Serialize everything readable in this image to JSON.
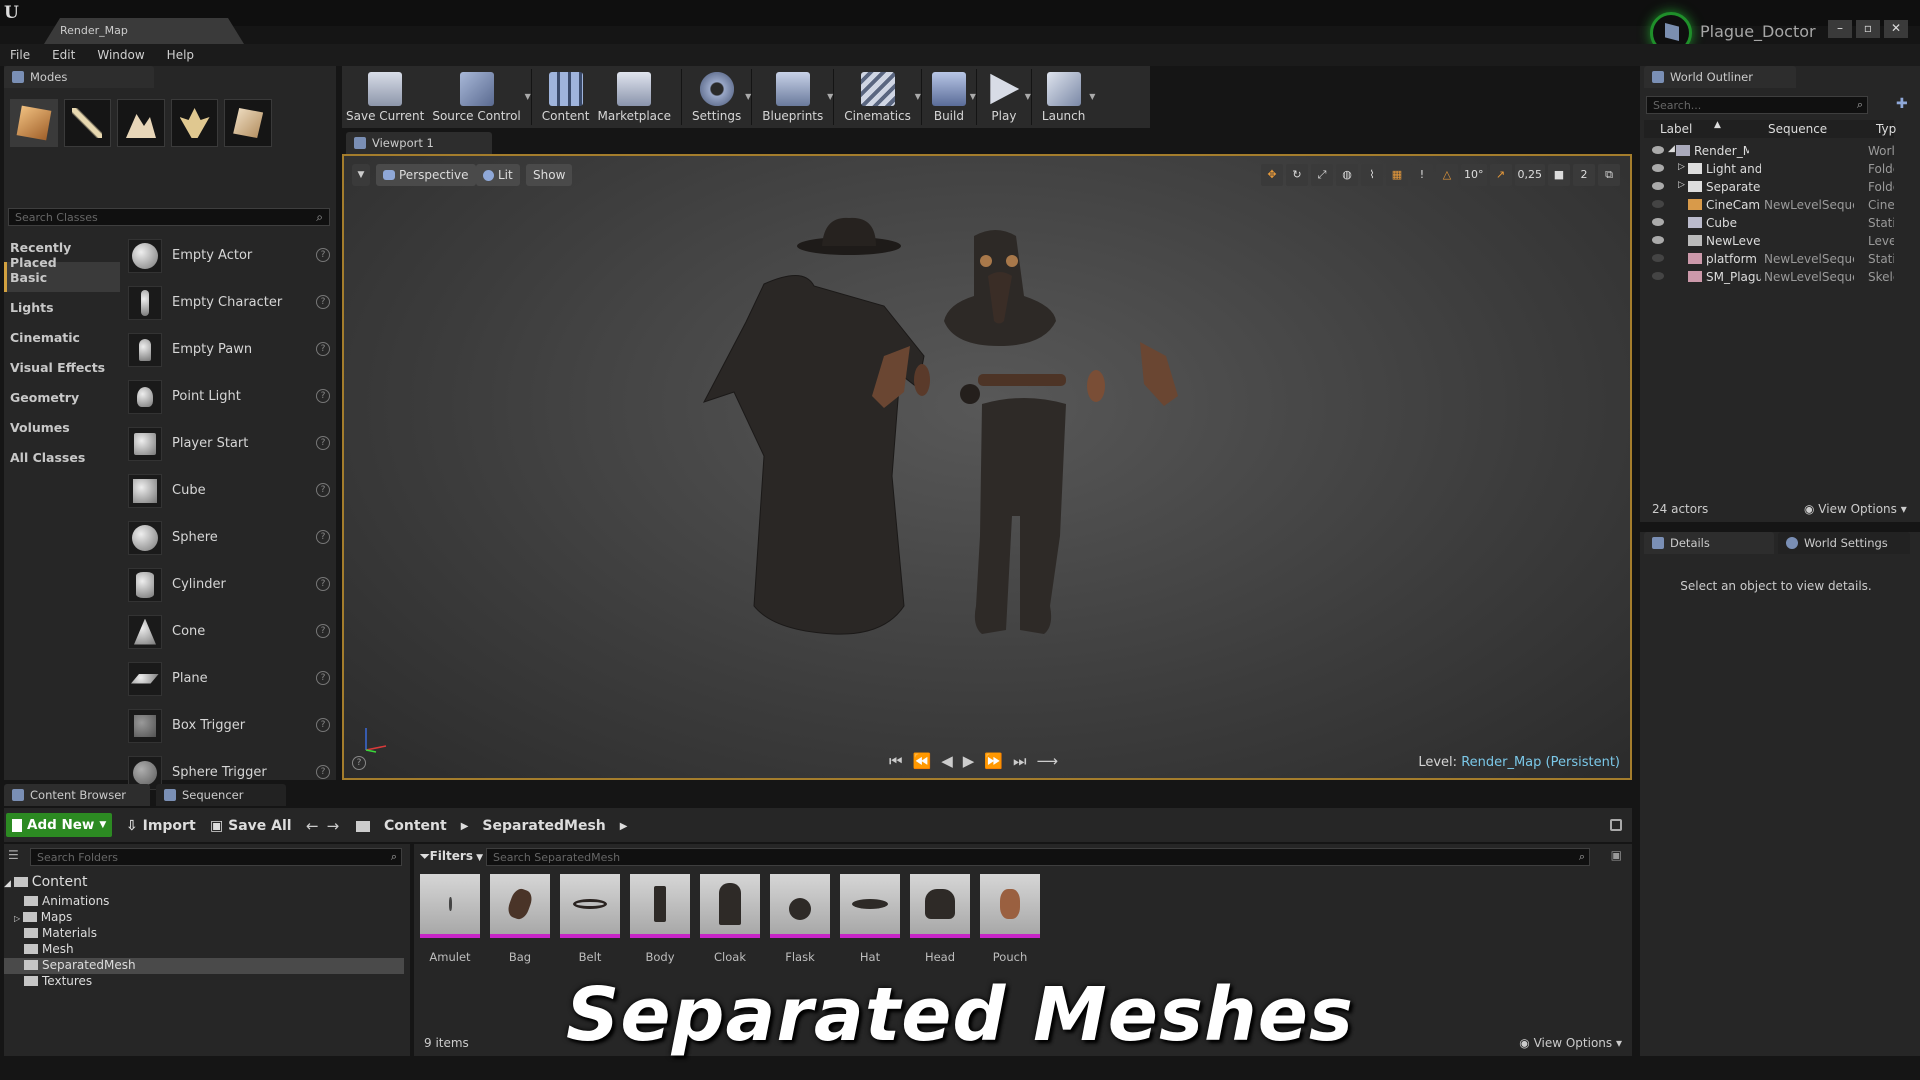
{
  "window": {
    "doc_tab": "Render_Map",
    "project": "Plague_Doctor"
  },
  "menu": [
    "File",
    "Edit",
    "Window",
    "Help"
  ],
  "modes": {
    "tab": "Modes",
    "search_placeholder": "Search Classes",
    "categories": [
      "Recently Placed",
      "Basic",
      "Lights",
      "Cinematic",
      "Visual Effects",
      "Geometry",
      "Volumes",
      "All Classes"
    ],
    "items": [
      "Empty Actor",
      "Empty Character",
      "Empty Pawn",
      "Point Light",
      "Player Start",
      "Cube",
      "Sphere",
      "Cylinder",
      "Cone",
      "Plane",
      "Box Trigger",
      "Sphere Trigger"
    ]
  },
  "toolbar": {
    "save": "Save Current",
    "source": "Source Control",
    "content": "Content",
    "marketplace": "Marketplace",
    "settings": "Settings",
    "blueprints": "Blueprints",
    "cinematics": "Cinematics",
    "build": "Build",
    "play": "Play",
    "launch": "Launch"
  },
  "viewport": {
    "tab": "Viewport 1",
    "perspective": "Perspective",
    "lit": "Lit",
    "show": "Show",
    "angle_snap": "10°",
    "scale_snap": "0,25",
    "camera_speed": "2",
    "level_label": "Level:",
    "level_name": "Render_Map (Persistent)"
  },
  "outliner": {
    "tab": "World Outliner",
    "search_placeholder": "Search...",
    "col_label": "Label",
    "col_sequence": "Sequence",
    "col_type": "Typ",
    "rows": [
      {
        "label": "Render_Map",
        "sequence": "",
        "type": "World"
      },
      {
        "label": "Light and",
        "sequence": "",
        "type": "Folder"
      },
      {
        "label": "Separated",
        "sequence": "",
        "type": "Folder"
      },
      {
        "label": "CineCam",
        "sequence": "NewLevelSequence",
        "type": "CineCar"
      },
      {
        "label": "Cube",
        "sequence": "",
        "type": "StaticM"
      },
      {
        "label": "NewLevel",
        "sequence": "",
        "type": "LevelSe"
      },
      {
        "label": "platform",
        "sequence": "NewLevelSequence",
        "type": "StaticM"
      },
      {
        "label": "SM_Plagu",
        "sequence": "NewLevelSequence",
        "type": "Skeletal"
      }
    ],
    "actor_count": "24 actors",
    "view_options": "View Options"
  },
  "details": {
    "tab": "Details",
    "world_tab": "World Settings",
    "empty_msg": "Select an object to view details."
  },
  "content_browser": {
    "tab": "Content Browser",
    "sequencer_tab": "Sequencer",
    "add_new": "Add New",
    "import": "Import",
    "save_all": "Save All",
    "path": [
      "Content",
      "SeparatedMesh"
    ],
    "folder_search": "Search Folders",
    "asset_search": "Search SeparatedMesh",
    "filters": "Filters",
    "folders": {
      "root": "Content",
      "children": [
        "Animations",
        "Maps",
        "Materials",
        "Mesh",
        "SeparatedMesh",
        "Textures"
      ]
    },
    "assets": [
      "Amulet",
      "Bag",
      "Belt",
      "Body",
      "Cloak",
      "Flask",
      "Hat",
      "Head",
      "Pouch"
    ],
    "item_count": "9 items",
    "view_options": "View Options"
  },
  "caption": "Separated Meshes",
  "colors": {
    "accent": "#d2a140",
    "add_new": "#2c8a22",
    "asset_border": "#c826c8",
    "level_name": "#7bc8e8",
    "project_ring": "#1f8f2a"
  }
}
